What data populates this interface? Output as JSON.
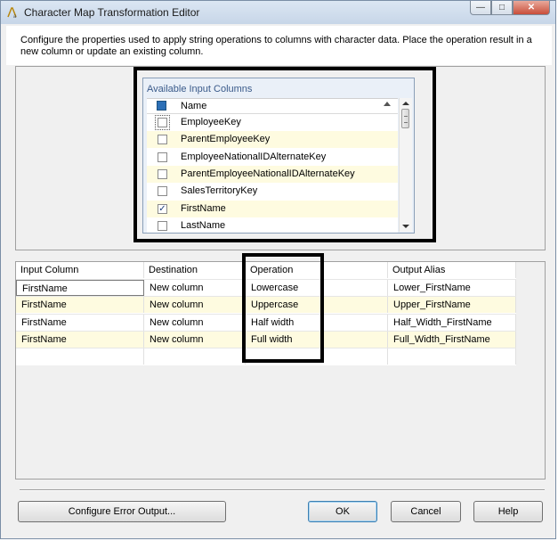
{
  "window": {
    "title": "Character Map Transformation Editor",
    "controls": [
      "minimize",
      "maximize",
      "close"
    ]
  },
  "description": "Configure the properties used to apply string operations to columns with character data. Place the operation result in a new column or update an existing column.",
  "available_columns": {
    "title": "Available Input Columns",
    "header": "Name",
    "items": [
      {
        "name": "EmployeeKey",
        "checked": false
      },
      {
        "name": "ParentEmployeeKey",
        "checked": false
      },
      {
        "name": "EmployeeNationalIDAlternateKey",
        "checked": false
      },
      {
        "name": "ParentEmployeeNationalIDAlternateKey",
        "checked": false
      },
      {
        "name": "SalesTerritoryKey",
        "checked": false
      },
      {
        "name": "FirstName",
        "checked": true
      },
      {
        "name": "LastName",
        "checked": false
      }
    ]
  },
  "mapping_table": {
    "columns": [
      "Input Column",
      "Destination",
      "Operation",
      "Output Alias"
    ],
    "rows": [
      [
        "FirstName",
        "New column",
        "Lowercase",
        "Lower_FirstName"
      ],
      [
        "FirstName",
        "New column",
        "Uppercase",
        "Upper_FirstName"
      ],
      [
        "FirstName",
        "New column",
        "Half width",
        "Half_Width_FirstName"
      ],
      [
        "FirstName",
        "New column",
        "Full width",
        "Full_Width_FirstName"
      ]
    ]
  },
  "buttons": {
    "configure_error": "Configure Error Output...",
    "ok": "OK",
    "cancel": "Cancel",
    "help": "Help"
  },
  "colors": {
    "alt_row": "#fefbe0",
    "highlight_border": "#000000"
  }
}
